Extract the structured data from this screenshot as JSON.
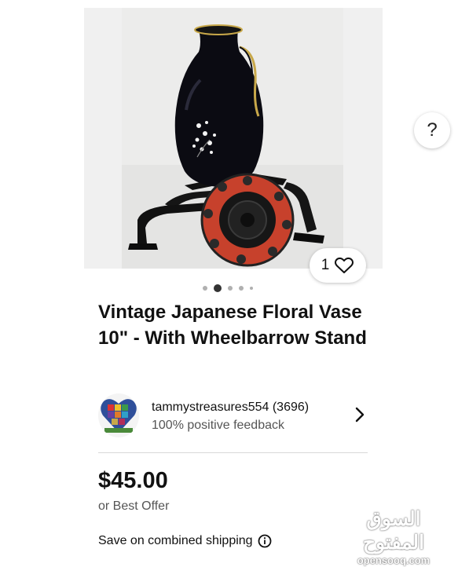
{
  "listing": {
    "help_label": "?",
    "watch_count": "1",
    "image_dots": 5,
    "title": "Vintage Japanese Floral Vase 10\" - With Wheelbarrow Stand",
    "price": "$45.00",
    "offer": "or Best Offer",
    "shipping": "Save on combined shipping"
  },
  "seller": {
    "name_line": "tammystreasures554 (3696)",
    "feedback": "100% positive feedback"
  },
  "watermark": {
    "arabic": "السوق المفتوح",
    "latin": "opensooq.com"
  },
  "icons": {
    "help": "question-icon",
    "watch": "heart-icon",
    "seller_link": "chevron-right-icon",
    "shipping_info": "info-icon"
  }
}
